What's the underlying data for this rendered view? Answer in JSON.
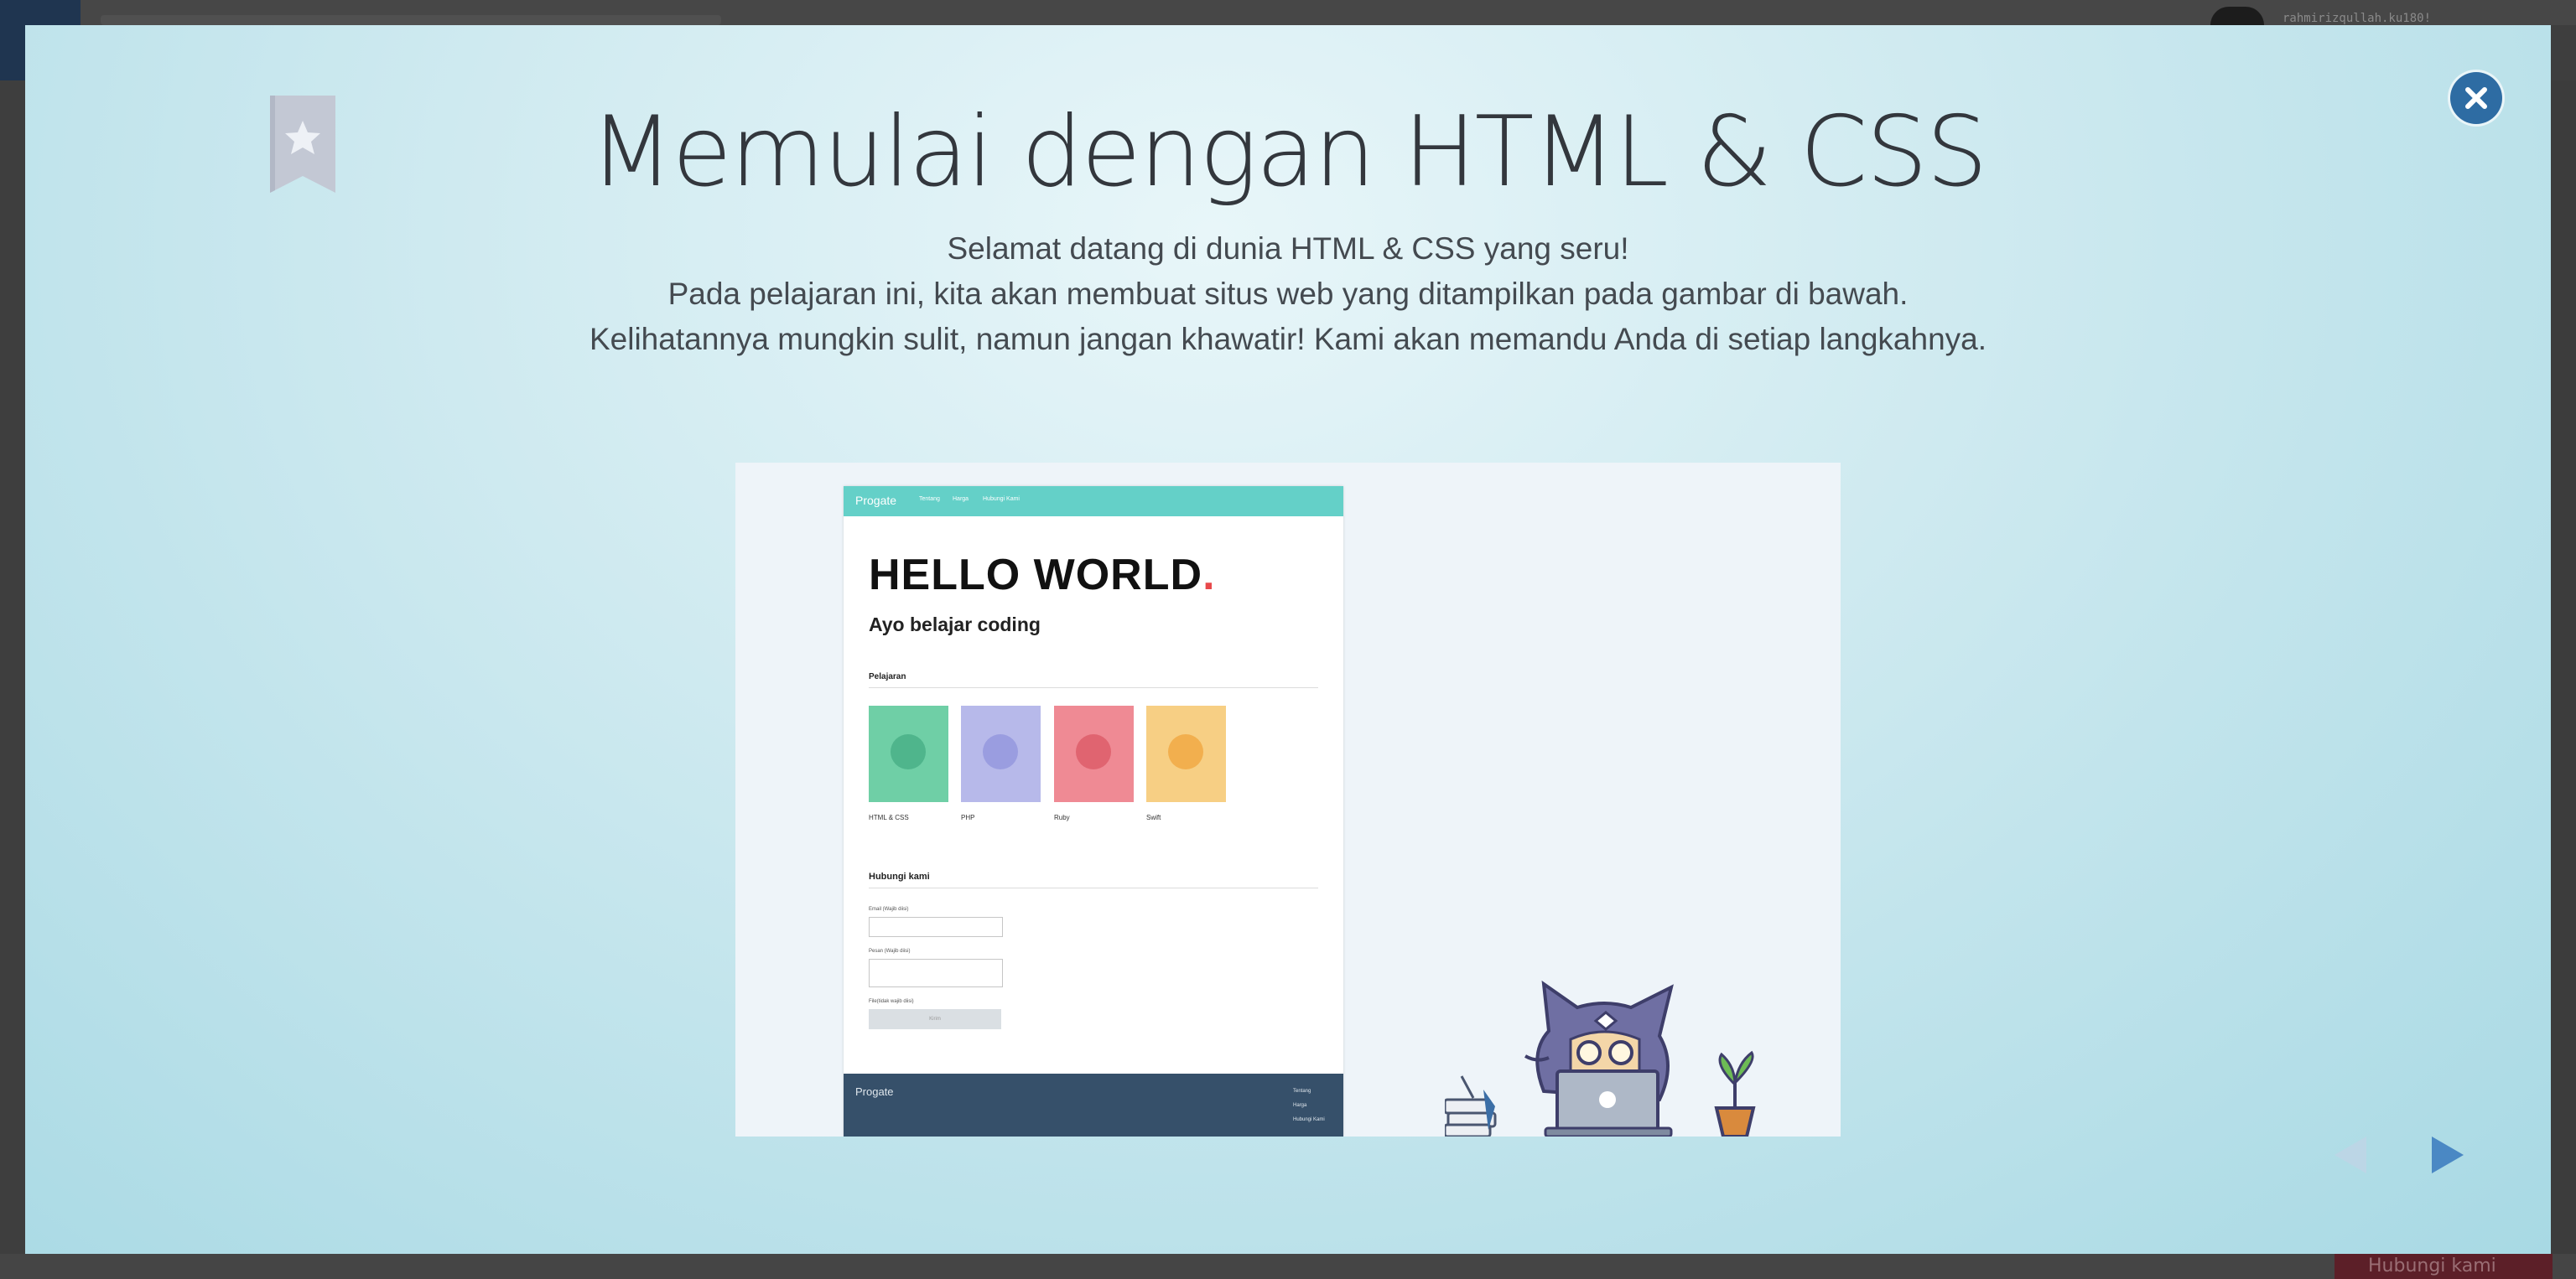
{
  "background": {
    "username": "rahmirizqullah.ku180!",
    "contact_label": "Hubungi kami"
  },
  "modal": {
    "title": "Memulai dengan HTML & CSS",
    "intro_lines": [
      "Selamat datang di dunia HTML & CSS yang seru!",
      "Pada pelajaran ini, kita akan membuat situs web yang ditampilkan pada gambar di bawah.",
      "Kelihatannya mungkin sulit, namun jangan khawatir! Kami akan memandu Anda di setiap langkahnya."
    ],
    "icons": {
      "bookmark": "bookmark-star-icon",
      "close": "close-icon",
      "prev": "triangle-left-icon",
      "next": "triangle-right-icon"
    },
    "colors": {
      "close_button": "#2e6ca3",
      "nav_arrow": "#4a88c4",
      "nav_arrow_disabled": "#bcd6e6",
      "bookmark": "#c3c8d4"
    }
  },
  "preview_site": {
    "brand": "Progate",
    "nav_links": [
      "Tentang",
      "Harga",
      "Hubungi Kami"
    ],
    "hero_title": "HELLO WORLD",
    "hero_dot": ".",
    "hero_subtitle": "Ayo belajar coding",
    "lessons_heading": "Pelajaran",
    "lessons": [
      {
        "label": "HTML & CSS",
        "color": "#6fcfa6"
      },
      {
        "label": "PHP",
        "color": "#b7b9ea"
      },
      {
        "label": "Ruby",
        "color": "#ef8a94"
      },
      {
        "label": "Swift",
        "color": "#f7cf84"
      }
    ],
    "contact_heading": "Hubungi kami",
    "form": {
      "email_label": "Email (Wajib diisi)",
      "message_label": "Pesan (Wajib diisi)",
      "file_label": "File(tidak wajib diisi)",
      "submit_label": "Kirim"
    },
    "footer": {
      "brand": "Progate",
      "links": [
        "Tentang",
        "Harga",
        "Hubungi Kami"
      ]
    }
  }
}
